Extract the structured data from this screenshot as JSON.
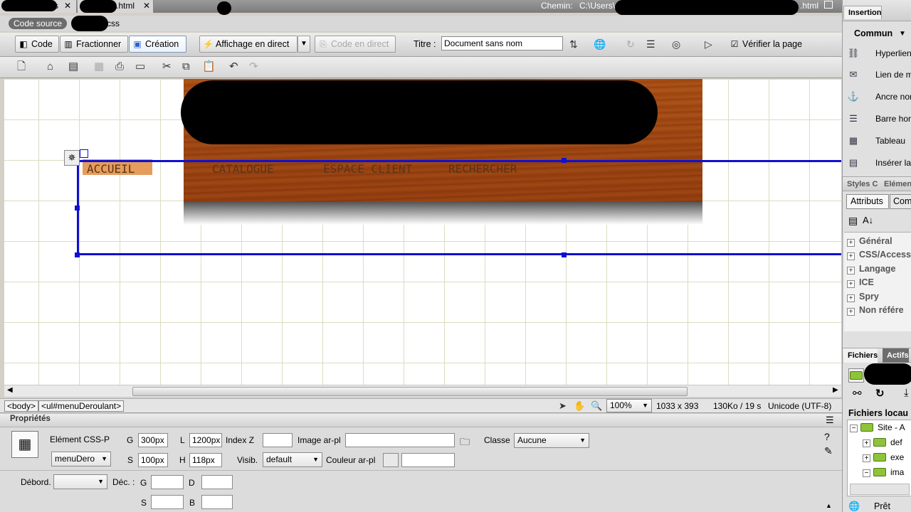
{
  "title_bar": {
    "tab1_label": "s",
    "tab2_label": ".html",
    "chemin_label": "Chemin:",
    "chemin_value": "C:\\Users\\",
    "chemin_suffix": ".html",
    "restore_icon": "restore-icon"
  },
  "related_files": {
    "code_source": "Code source",
    "css_file": "css"
  },
  "doc_toolbar": {
    "code": "Code",
    "split": "Fractionner",
    "design": "Création",
    "live_view": "Affichage en direct",
    "live_code": "Code en direct",
    "title_label": "Titre :",
    "title_value": "Document sans nom",
    "check_page": "Vérifier la page"
  },
  "design_view": {
    "nav_items": [
      "ACCUEIL",
      "CATALOGUE",
      "ESPACE CLIENT",
      "RECHERCHER"
    ]
  },
  "status_bar": {
    "tag_body": "<body>",
    "tag_ul": "<ul#menuDeroulant>",
    "zoom": "100%",
    "dimensions": "1033 x 393",
    "download": "130Ko / 19 s",
    "encoding": "Unicode (UTF-8)"
  },
  "properties": {
    "header": "Propriétés",
    "element_type": "Elément CSS-P",
    "element_id": "menuDero",
    "g_label": "G",
    "g_value": "300px",
    "l_label": "L",
    "l_value": "1200px",
    "z_label": "Index Z",
    "z_value": "",
    "bgimg_label": "Image ar-pl",
    "bgimg_value": "",
    "class_label": "Classe",
    "class_value": "Aucune",
    "s_label": "S",
    "s_value": "100px",
    "h_label": "H",
    "h_value": "118px",
    "vis_label": "Visib.",
    "vis_value": "default",
    "bgcolor_label": "Couleur ar-pl",
    "bgcolor_value": "",
    "overflow_label": "Débord.",
    "overflow_value": "",
    "clip_label": "Déc. :",
    "clip_g": "G",
    "clip_d": "D",
    "clip_s": "S",
    "clip_b": "B"
  },
  "right_panel": {
    "insert_tab": "Insertion",
    "category": "Commun",
    "items": [
      "Hyperlien",
      "Lien de m",
      "Ancre nor",
      "Barre hor",
      "Tableau",
      "Insérer la"
    ],
    "styles_tab": "Styles C",
    "elements_tab": "Elémen",
    "attributes_tab": "Attributs",
    "comp_tab": "Com",
    "categories": [
      "Général",
      "CSS/Access",
      "Langage",
      "ICE",
      "Spry",
      "Non référe"
    ],
    "files_tab": "Fichiers",
    "assets_tab": "Actifs",
    "local_files": "Fichiers locau",
    "tree": [
      "Site - A",
      "def",
      "exe",
      "ima"
    ],
    "ready": "Prêt"
  }
}
